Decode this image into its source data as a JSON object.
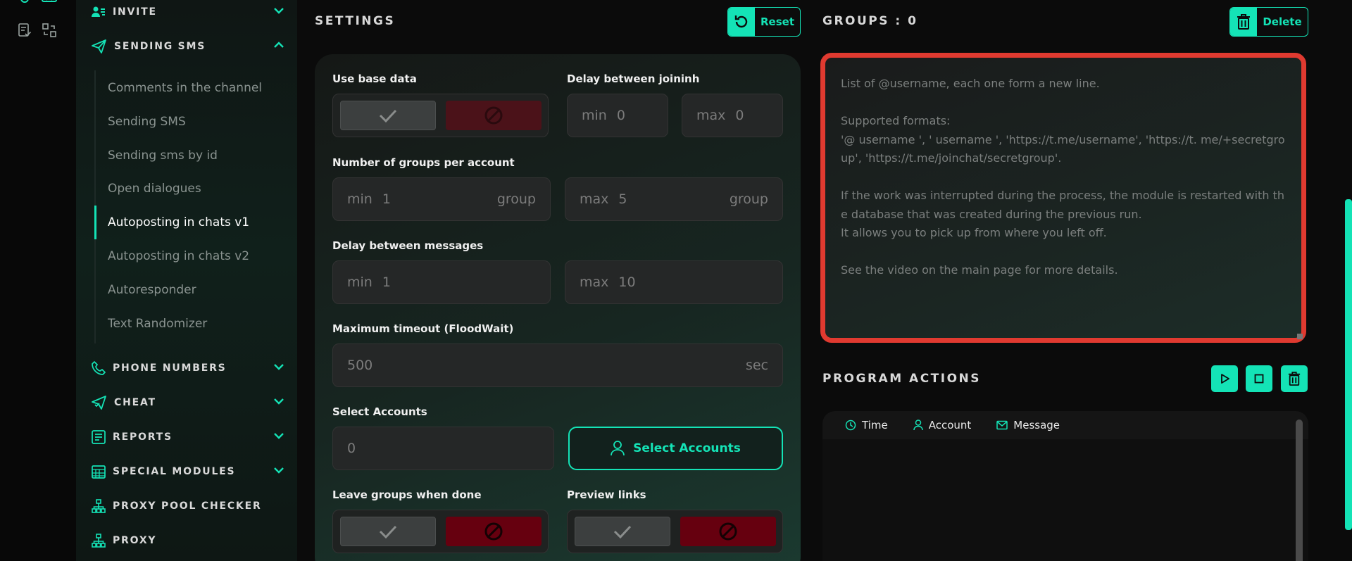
{
  "sidebar": {
    "sections": {
      "invite": "INVITE",
      "sending_sms": "SENDING SMS",
      "phone_numbers": "PHONE NUMBERS",
      "cheat": "CHEAT",
      "reports": "REPORTS",
      "special_modules": "SPECIAL MODULES",
      "proxy_pool_checker": "PROXY POOL CHECKER",
      "proxy": "PROXY"
    },
    "sms_items": [
      "Comments in the channel",
      "Sending SMS",
      "Sending sms by id",
      "Open dialogues",
      "Autoposting in chats v1",
      "Autoposting in chats v2",
      "Autoresponder",
      "Text Randomizer"
    ],
    "active_item": "Autoposting in chats v1"
  },
  "settings": {
    "title": "SETTINGS",
    "reset_label": "Reset",
    "use_base_data": "Use base data",
    "delay_joining": "Delay between joininh",
    "delay_joining_min": {
      "prefix": "min",
      "value": "0"
    },
    "delay_joining_max": {
      "prefix": "max",
      "value": "0"
    },
    "groups_per_account": "Number of groups per account",
    "groups_min": {
      "prefix": "min",
      "value": "1",
      "suffix": "group"
    },
    "groups_max": {
      "prefix": "max",
      "value": "5",
      "suffix": "group"
    },
    "delay_messages": "Delay between messages",
    "msg_min": {
      "prefix": "min",
      "value": "1"
    },
    "msg_max": {
      "prefix": "max",
      "value": "10"
    },
    "max_timeout": "Maximum timeout (FloodWait)",
    "timeout_value": "500",
    "timeout_suffix": "sec",
    "select_accounts_label": "Select Accounts",
    "accounts_count": "0",
    "select_accounts_button": "Select Accounts",
    "leave_groups": "Leave groups when done",
    "preview_links": "Preview links"
  },
  "groups": {
    "title": "GROUPS : 0",
    "delete_label": "Delete",
    "placeholder": "List of @username, each one form a new line.\n\nSupported formats:\n'@ username ', ' username ', 'https://t.me/username', 'https://t. me/+secretgroup', 'https://t.me/joinchat/secretgroup'.\n\nIf the work was interrupted during the process, the module is restarted with the database that was created during the previous run.\nIt allows you to pick up from where you left off.\n\nSee the video on the main page for more details."
  },
  "program_actions": {
    "title": "PROGRAM ACTIONS",
    "columns": [
      "Time",
      "Account",
      "Message"
    ]
  },
  "colors": {
    "accent": "#14e3b6",
    "highlight_border": "#e03a30",
    "danger": "#66000f"
  }
}
